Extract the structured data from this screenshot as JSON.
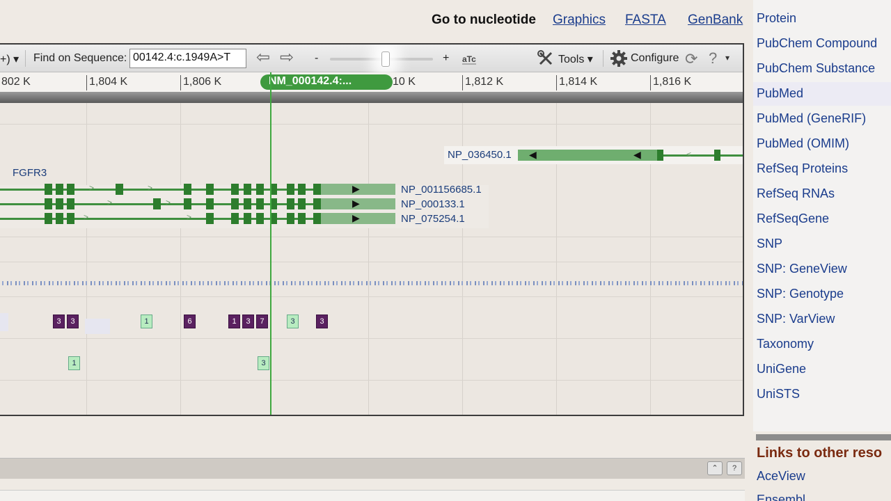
{
  "header": {
    "goto_label": "Go to nucleotide",
    "links": [
      "Graphics",
      "FASTA",
      "GenBank"
    ]
  },
  "toolbar": {
    "partial_button": "+) ▾",
    "find_label": "Find on Sequence:",
    "find_value": "00142.4:c.1949A>T",
    "zoom_minus": "-",
    "zoom_plus": "+",
    "tools_label": "Tools",
    "configure_label": "Configure"
  },
  "ruler": {
    "ticks": [
      "802 K",
      "1,804 K",
      "1,806 K",
      "10 K",
      "1,812 K",
      "1,814 K",
      "1,816 K"
    ],
    "marker_label": "NM_000142.4:..."
  },
  "tracks": {
    "gene_name": "FGFR3",
    "proteins": [
      "NP_036450.1",
      "NP_001156685.1",
      "NP_000133.1",
      "NP_075254.1"
    ],
    "variants_row1": [
      "3",
      "3",
      "1",
      "6",
      "1",
      "3",
      "7",
      "3",
      "3"
    ],
    "variants_row2": [
      "1",
      "3"
    ]
  },
  "sidebar": {
    "items": [
      "Protein",
      "PubChem Compound",
      "PubChem Substance",
      "PubMed",
      "PubMed (GeneRIF)",
      "PubMed (OMIM)",
      "RefSeq Proteins",
      "RefSeq RNAs",
      "RefSeqGene",
      "SNP",
      "SNP: GeneView",
      "SNP: Genotype",
      "SNP: VarView",
      "Taxonomy",
      "UniGene",
      "UniSTS"
    ],
    "other_resources_title": "Links to other reso",
    "other_items": [
      "AceView",
      "Ensembl"
    ]
  },
  "colors": {
    "gene_green": "#2d7d2d",
    "variant_purple": "#5a2160",
    "variant_mint": "#b8ecc0",
    "link_blue": "#1a3c8c"
  }
}
